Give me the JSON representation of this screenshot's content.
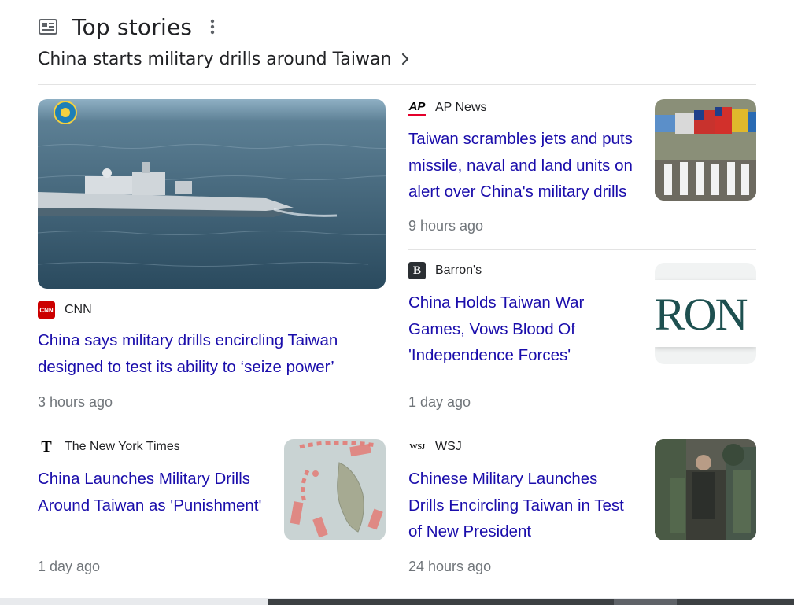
{
  "header": {
    "title": "Top stories",
    "icon": "newspaper-icon"
  },
  "topic": {
    "label": "China starts military drills around Taiwan"
  },
  "stories": [
    {
      "source": "CNN",
      "logo": "CNN",
      "headline": "China says military drills encircling Taiwan designed to test its ability to ‘seize power’",
      "time": "3 hours ago"
    },
    {
      "source": "AP News",
      "logo": "AP",
      "headline": "Taiwan scrambles jets and puts missile, naval and land units on alert over China's military drills",
      "time": "9 hours ago"
    },
    {
      "source": "Barron's",
      "logo": "B",
      "headline": "China Holds Taiwan War Games, Vows Blood Of 'Independence Forces'",
      "time": "1 day ago"
    },
    {
      "source": "The New York Times",
      "logo": "T",
      "headline": "China Launches Military Drills Around Taiwan as 'Punishment'",
      "time": "1 day ago"
    },
    {
      "source": "WSJ",
      "logo": "WSJ",
      "headline": "Chinese Military Launches Drills Encircling Taiwan in Test of New President",
      "time": "24 hours ago"
    }
  ],
  "thumbnails": {
    "barrons_text": "RON"
  },
  "colors": {
    "link": "#1a0dab",
    "meta": "#70757a",
    "divider": "#e3e3e3",
    "cnn_red": "#cc0000",
    "ap_red": "#e4002b"
  }
}
